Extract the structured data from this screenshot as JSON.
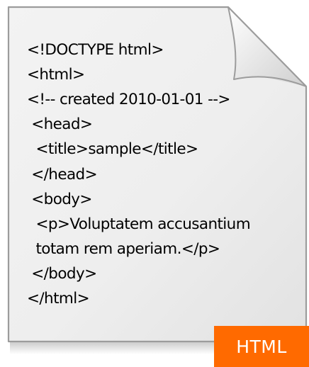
{
  "document": {
    "icon": "file-page-icon",
    "lines": [
      "<!DOCTYPE html>",
      "<html>",
      "<!-- created 2010-01-01 -->",
      " <head>",
      "  <title>sample</title>",
      " </head>",
      " <body>",
      "  <p>Voluptatem accusantium",
      "  totam rem aperiam.</p>",
      " </body>",
      "</html>"
    ]
  },
  "badge": {
    "label": "HTML",
    "color": "#ff6a00",
    "text_color": "#ffffff"
  },
  "colors": {
    "page_fill": "#ececec",
    "page_border": "#9a9a9a",
    "text": "#000000"
  }
}
